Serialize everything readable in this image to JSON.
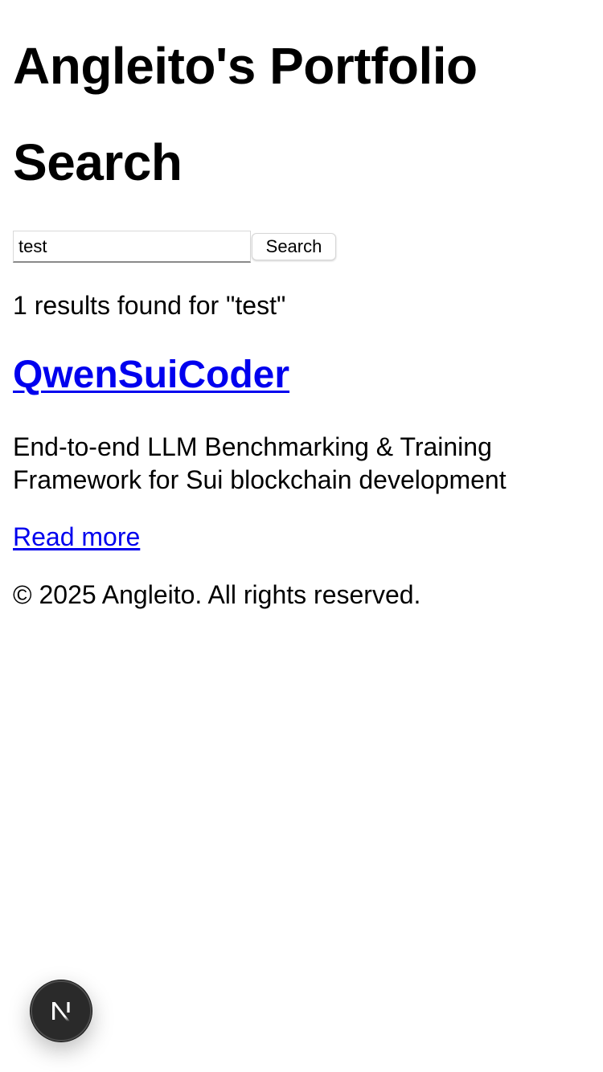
{
  "header": {
    "site_title": "Angleito's Portfolio"
  },
  "search": {
    "heading": "Search",
    "input_value": "test",
    "button_label": "Search"
  },
  "results": {
    "summary": "1 results found for \"test\"",
    "items": [
      {
        "title": "QwenSuiCoder",
        "description": "End-to-end LLM Benchmarking & Training Framework for Sui blockchain development",
        "link_label": "Read more"
      }
    ]
  },
  "footer": {
    "copyright": "© 2025 Angleito. All rights reserved."
  },
  "dev_indicator": {
    "icon": "nextjs-logo-icon",
    "letter": "N"
  },
  "colors": {
    "link": "#0000ee",
    "text": "#000000",
    "background": "#ffffff",
    "badge": "#2a2a2a"
  }
}
